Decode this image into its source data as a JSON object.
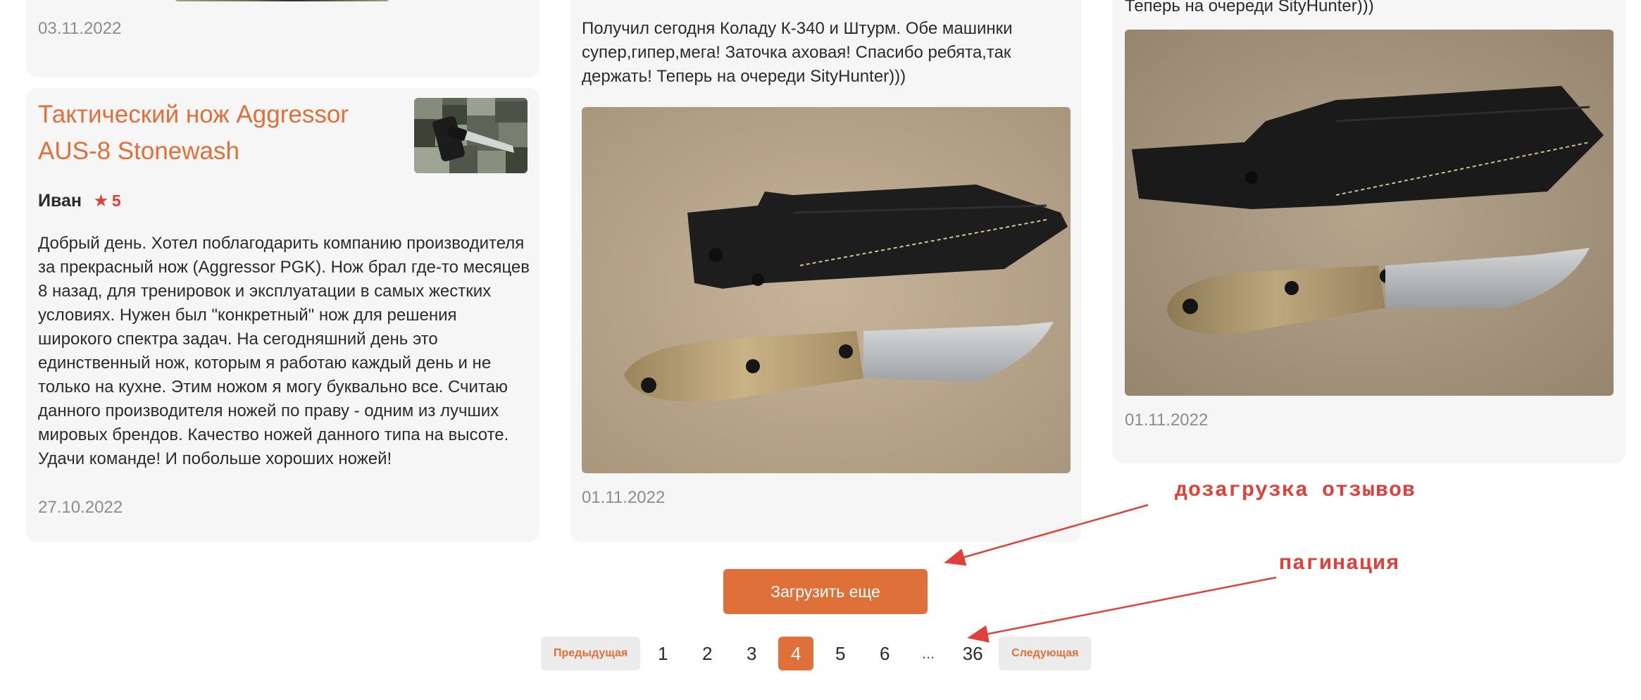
{
  "reviews": {
    "top_left_date": "03.11.2022",
    "left": {
      "product_title": "Тактический нож Aggressor AUS-8 Stonewash",
      "author": "Иван",
      "rating": "5",
      "text": "Добрый день. Хотел поблагодарить компанию производителя за прекрасный нож (Aggressor PGK). Нож брал где-то месяцев 8 назад, для тренировок и эксплуатации в самых жестких условиях. Нужен был \"конкретный\" нож для решения широкого спектра задач. На сегодняшний день это единственный нож, которым я работаю каждый день и не только на кухне. Этим ножом я могу буквально все. Считаю данного производителя ножей по праву - одним из лучших мировых брендов. Качество ножей данного типа на высоте. Удачи команде! И побольше хороших ножей!",
      "date": "27.10.2022"
    },
    "middle": {
      "text": "Получил сегодня Коладу К-340 и Штурм. Обе машинки супер,гипер,мега! Заточка аховая! Спасибо ребята,так держать! Теперь на очереди SityHunter)))",
      "date": "01.11.2022"
    },
    "right": {
      "text_tail": "Теперь на очереди SityHunter)))",
      "date": "01.11.2022"
    }
  },
  "load_more_label": "Загрузить еще",
  "pagination": {
    "prev_label": "Предыдущая",
    "next_label": "Следующая",
    "pages": [
      "1",
      "2",
      "3",
      "4",
      "5",
      "6"
    ],
    "ellipsis": "...",
    "last_page": "36",
    "current": "4"
  },
  "annotations": {
    "load_more_note": "дозагрузка отзывов",
    "pagination_note": "пагинация"
  },
  "colors": {
    "accent": "#e0703a",
    "annotation": "#e0403a",
    "card_bg": "#f6f6f6"
  },
  "icons": {
    "rating": "star-icon"
  }
}
